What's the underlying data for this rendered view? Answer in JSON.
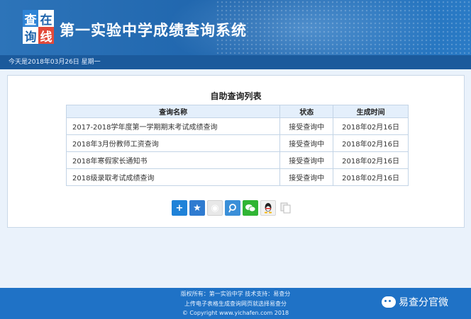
{
  "header": {
    "logo_chars": [
      "查",
      "在",
      "询",
      "线"
    ],
    "title": "第一实验中学成绩查询系统",
    "date_line": "今天是2018年03月26日 星期一"
  },
  "main": {
    "title": "自助查询列表",
    "columns": [
      "查询名称",
      "状态",
      "生成时间"
    ],
    "rows": [
      {
        "name": "2017-2018学年度第一学期期末考试成绩查询",
        "status": "接受查询中",
        "time": "2018年02月16日"
      },
      {
        "name": "2018年3月份教师工资查询",
        "status": "接受查询中",
        "time": "2018年02月16日"
      },
      {
        "name": "2018年寒假家长通知书",
        "status": "接受查询中",
        "time": "2018年02月16日"
      },
      {
        "name": "2018级录取考试成绩查询",
        "status": "接受查询中",
        "time": "2018年02月16日"
      }
    ]
  },
  "share": {
    "icons": [
      "plus-icon",
      "qzone-star-icon",
      "weibo-icon",
      "tencent-weibo-icon",
      "wechat-icon",
      "qq-icon",
      "copy-icon"
    ]
  },
  "footer": {
    "line1": "版权所有：第一实验中学  技术支持：易查分",
    "line2": "上传电子表格生成查询网页就选择易查分",
    "line3": "© Copyright www.yichafen.com 2018",
    "watermark": "易查分官微"
  },
  "colors": {
    "banner": "#1d63ab",
    "footer": "#1f72c6",
    "table_header": "#e4effb"
  }
}
